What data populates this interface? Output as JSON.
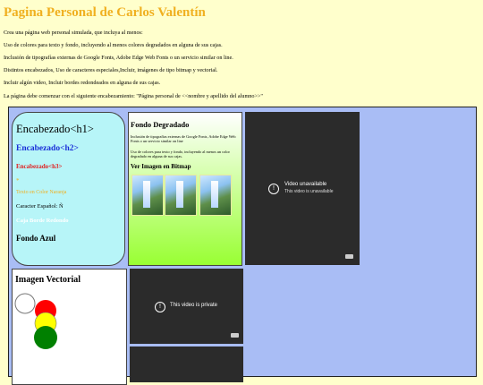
{
  "page": {
    "title": "Pagina Personal de Carlos Valentín",
    "paragraphs": [
      "Crea una página web personal simulada, que incluya al menos:",
      "Uso de colores para texto y fondo, incluyendo al menos colores degradados en alguna de sus cajas.",
      "Inclusión de tipografías externas de Google Fonts, Adobe Edge Web Fonts o un servicio similar on line.",
      "Distintos encabezados, Uso de caracteres especiales,Incluir, imágenes de tipo bitmap y vectorial.",
      "Incluir algún video, Incluir bordes redondeados en alguna de sus cajas.",
      "La página debe comenzar con el siguiente encabezamiento: \"Página personal de <<nombre y apellido del alumno>>\""
    ]
  },
  "box_headings": {
    "h1": "Encabezado<h1>",
    "h2": "Encabezado<h2>",
    "h3": "Encabezado<h3>",
    "dot": "*",
    "orange_text": "Texto en Color Naranja",
    "special_char": "Caracter Español: Ñ",
    "rounded": "Caja Borde Redondo",
    "blue_bg": "Fondo Azul"
  },
  "box_gradient": {
    "title": "Fondo Degradado",
    "text1": "Inclusión de tipografías externas de Google Fonts, Adobe Edge Web Fonts o un servicio similar on line",
    "text2": "Uso de colores para texto y fondo, incluyendo al menos un color degradado en alguna de sus cajas.",
    "bitmap_title": "Ver Imagen en Bitmap"
  },
  "video1": {
    "title": "Video unavailable",
    "subtitle": "This video is unavailable",
    "icon": "info-icon"
  },
  "box_vector": {
    "title": "Imagen Vectorial"
  },
  "video2": {
    "title": "This video is private",
    "icon": "info-icon"
  },
  "colors": {
    "page_bg": "#ffffcc",
    "title": "#f0b020",
    "frame_bg": "#a9bdf5",
    "headings_box": "#b7f5f8",
    "video_bg": "#2b2b2b",
    "light_red": "#ff0000",
    "light_yellow": "#ffff00",
    "light_green": "#008000"
  }
}
